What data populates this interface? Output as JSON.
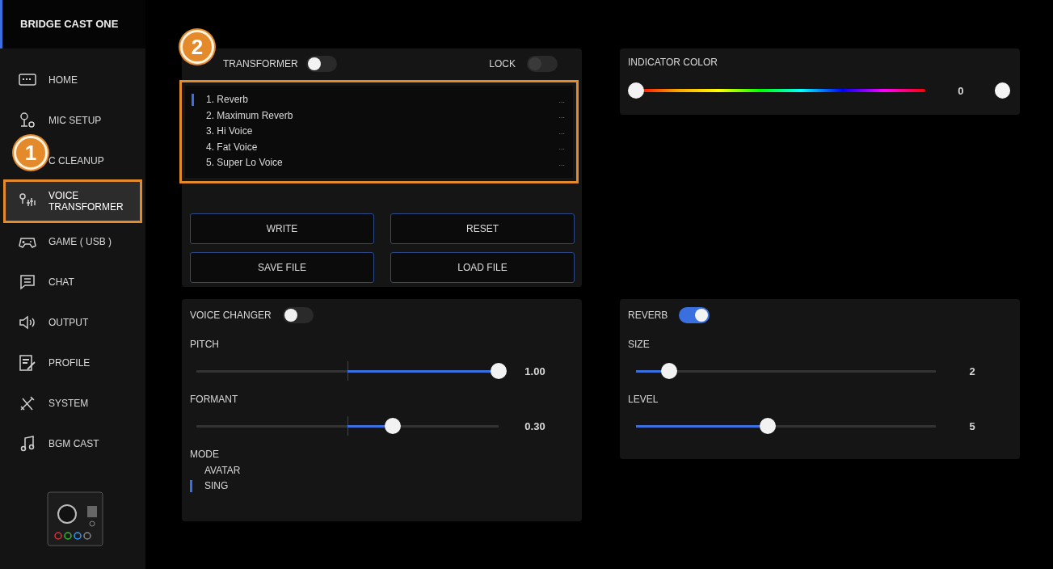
{
  "app_title": "BRIDGE CAST ONE",
  "sidebar": {
    "items": [
      {
        "label": "HOME",
        "selected": false,
        "highlighted": false
      },
      {
        "label": "MIC SETUP",
        "selected": false,
        "highlighted": false
      },
      {
        "label": "C CLEANUP",
        "selected": false,
        "highlighted": false
      },
      {
        "label": "VOICE TRANSFORMER",
        "selected": true,
        "highlighted": true
      },
      {
        "label": "GAME ( USB )",
        "selected": false,
        "highlighted": false
      },
      {
        "label": "CHAT",
        "selected": false,
        "highlighted": false
      },
      {
        "label": "OUTPUT",
        "selected": false,
        "highlighted": false
      },
      {
        "label": "PROFILE",
        "selected": false,
        "highlighted": false
      },
      {
        "label": "SYSTEM",
        "selected": false,
        "highlighted": false
      },
      {
        "label": "BGM CAST",
        "selected": false,
        "highlighted": false
      }
    ]
  },
  "callouts": [
    "1",
    "2"
  ],
  "transformer_panel": {
    "toggle_label": "TRANSFORMER",
    "toggle_on": false,
    "lock_label": "LOCK",
    "lock_on": false,
    "highlighted": true,
    "presets": [
      {
        "label": "1. Reverb",
        "more": "...",
        "selected": true
      },
      {
        "label": "2. Maximum Reverb",
        "more": "...",
        "selected": false
      },
      {
        "label": "3. Hi Voice",
        "more": "...",
        "selected": false
      },
      {
        "label": "4. Fat Voice",
        "more": "...",
        "selected": false
      },
      {
        "label": "5. Super Lo Voice",
        "more": "...",
        "selected": false
      }
    ],
    "buttons": [
      "WRITE",
      "RESET",
      "SAVE FILE",
      "LOAD FILE"
    ]
  },
  "indicator_color": {
    "title": "INDICATOR COLOR",
    "level": 0,
    "reading": "0"
  },
  "voice_changer": {
    "title": "VOICE CHANGER",
    "on": false,
    "sliders": [
      {
        "label": "PITCH",
        "kind": "bipolar",
        "level": 1,
        "reading": "1.00"
      },
      {
        "label": "FORMANT",
        "kind": "bipolar",
        "level": 0.65,
        "reading": "0.30"
      }
    ],
    "mode_label": "MODE",
    "modes": [
      {
        "label": "AVATAR",
        "selected": false
      },
      {
        "label": "SING",
        "selected": true
      }
    ]
  },
  "reverb": {
    "title": "REVERB",
    "on": true,
    "sliders": [
      {
        "label": "SIZE",
        "kind": "plain",
        "level": 0.11,
        "reading": "2"
      },
      {
        "label": "LEVEL",
        "kind": "plain",
        "level": 0.44,
        "reading": "5"
      }
    ]
  }
}
